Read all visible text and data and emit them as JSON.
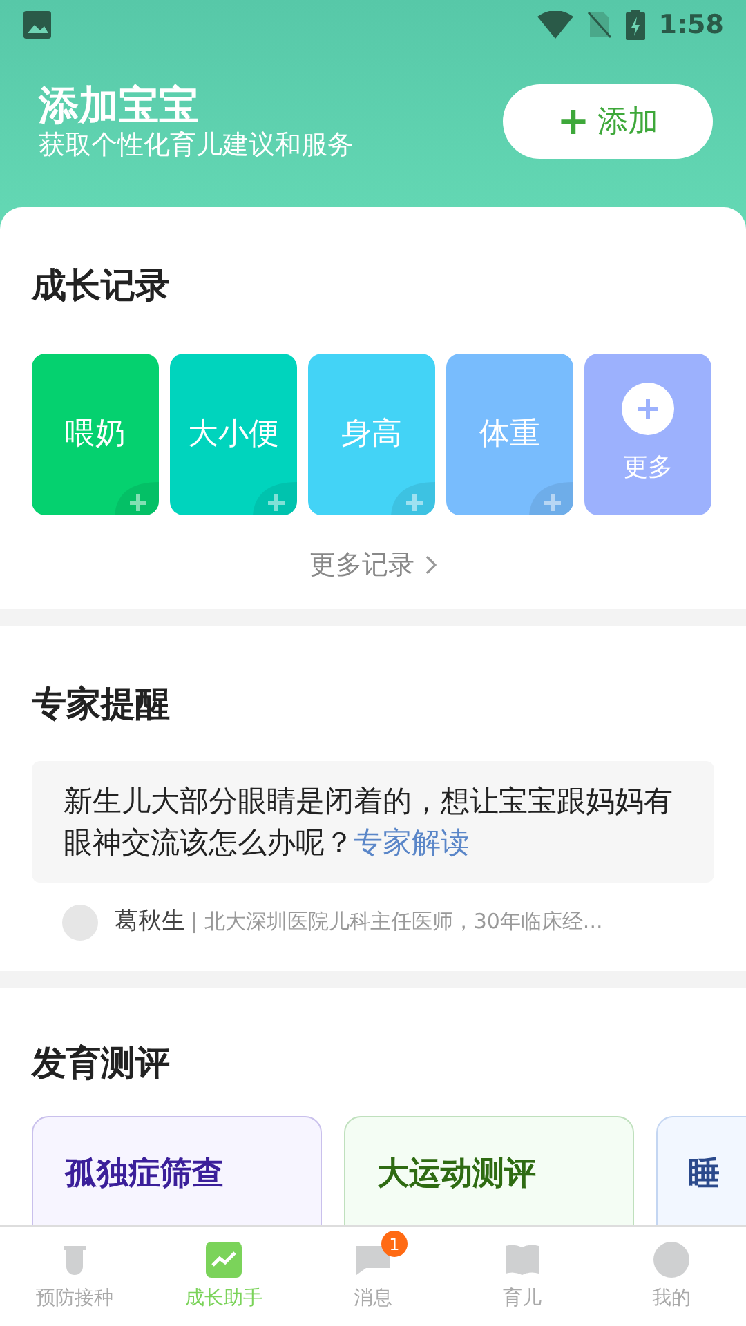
{
  "status_bar": {
    "time": "1:58"
  },
  "header": {
    "title": "添加宝宝",
    "subtitle": "获取个性化育儿建议和服务",
    "add_button": {
      "icon": "+",
      "label": "添加"
    }
  },
  "growth_records": {
    "title": "成长记录",
    "tiles": [
      {
        "kind": "record",
        "label": "喂奶",
        "color": "#05d16f"
      },
      {
        "kind": "record",
        "label": "大小便",
        "color": "#00d4bd"
      },
      {
        "kind": "record",
        "label": "身高",
        "color": "#43d3f6"
      },
      {
        "kind": "record",
        "label": "体重",
        "color": "#78bcfd"
      },
      {
        "kind": "more",
        "label": "更多",
        "color": "#9cb1fd"
      }
    ],
    "more_link": "更多记录"
  },
  "expert_tips": {
    "title": "专家提醒",
    "question": "新生儿大部分眼睛是闭着的，想让宝宝跟妈妈有眼神交流该怎么办呢？",
    "link": "专家解读",
    "doctor_name": "葛秋生",
    "separator": "|",
    "doctor_info": "北大深圳医院儿科主任医师，30年临床经..."
  },
  "assessments": {
    "title": "发育测评",
    "cards": [
      {
        "title": "孤独症筛查",
        "color": "#3b1f9a"
      },
      {
        "title": "大运动测评",
        "color": "#2e6b12"
      },
      {
        "title": "睡",
        "color": "#2b4a8c"
      }
    ]
  },
  "bottom_nav": [
    {
      "label": "预防接种",
      "selected": false
    },
    {
      "label": "成长助手",
      "selected": true
    },
    {
      "label": "消息",
      "selected": false,
      "badge": "1"
    },
    {
      "label": "育儿",
      "selected": false
    },
    {
      "label": "我的",
      "selected": false
    }
  ]
}
